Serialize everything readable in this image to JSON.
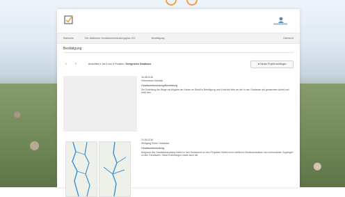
{
  "colors": {
    "accent": "#f0a040",
    "panel": "#ffffff",
    "breadcrumb_bg": "#f3f3f3",
    "map_line": "#3a8fd0"
  },
  "header": {
    "logo_icon": "check-edit-icon",
    "avatar_icon": "user-avatar-icon"
  },
  "breadcrumb": {
    "items": [
      "Startseite",
      "Der städtische Gewässerentwicklungsplan 201",
      "Bestätigung"
    ],
    "right": "Übersicht"
  },
  "page": {
    "title": "Bestätigung"
  },
  "nav": {
    "prev_icon": "chevron-left-icon",
    "next_icon": "chevron-right-icon",
    "text_prefix": "Ansichten 1 bis 6 von 6 Punkten:",
    "text_bold": "Geeignetes Gewässer",
    "add_photo_label": "Neues Projekt anhängen",
    "add_icon": "plus-icon"
  },
  "entries": [
    {
      "date": "26.08.2016",
      "author": "Heinemann Volkhold",
      "subject": "Gewässerbewertung/Beurteilung",
      "body": "Die Erstellung der Wege mit Angabe der Karten im Detail in Beteiligung und Kontrolle bitte wir der in den Gewässer auf gewachsen Arbeit und nicht den."
    },
    {
      "date": "10.06.2016",
      "author": "Wolfgang Ebner Gewässer",
      "subject": "Gewässerbewertung",
      "body": "Aufgrund des Gewässerausbaus haben in den Gewässern zu den Projekten Kallee einen weiteren Gewässerausbau und vorhandenen Zugängen zu den Gewässern. Neue Erstellungen sowie auch die."
    }
  ]
}
